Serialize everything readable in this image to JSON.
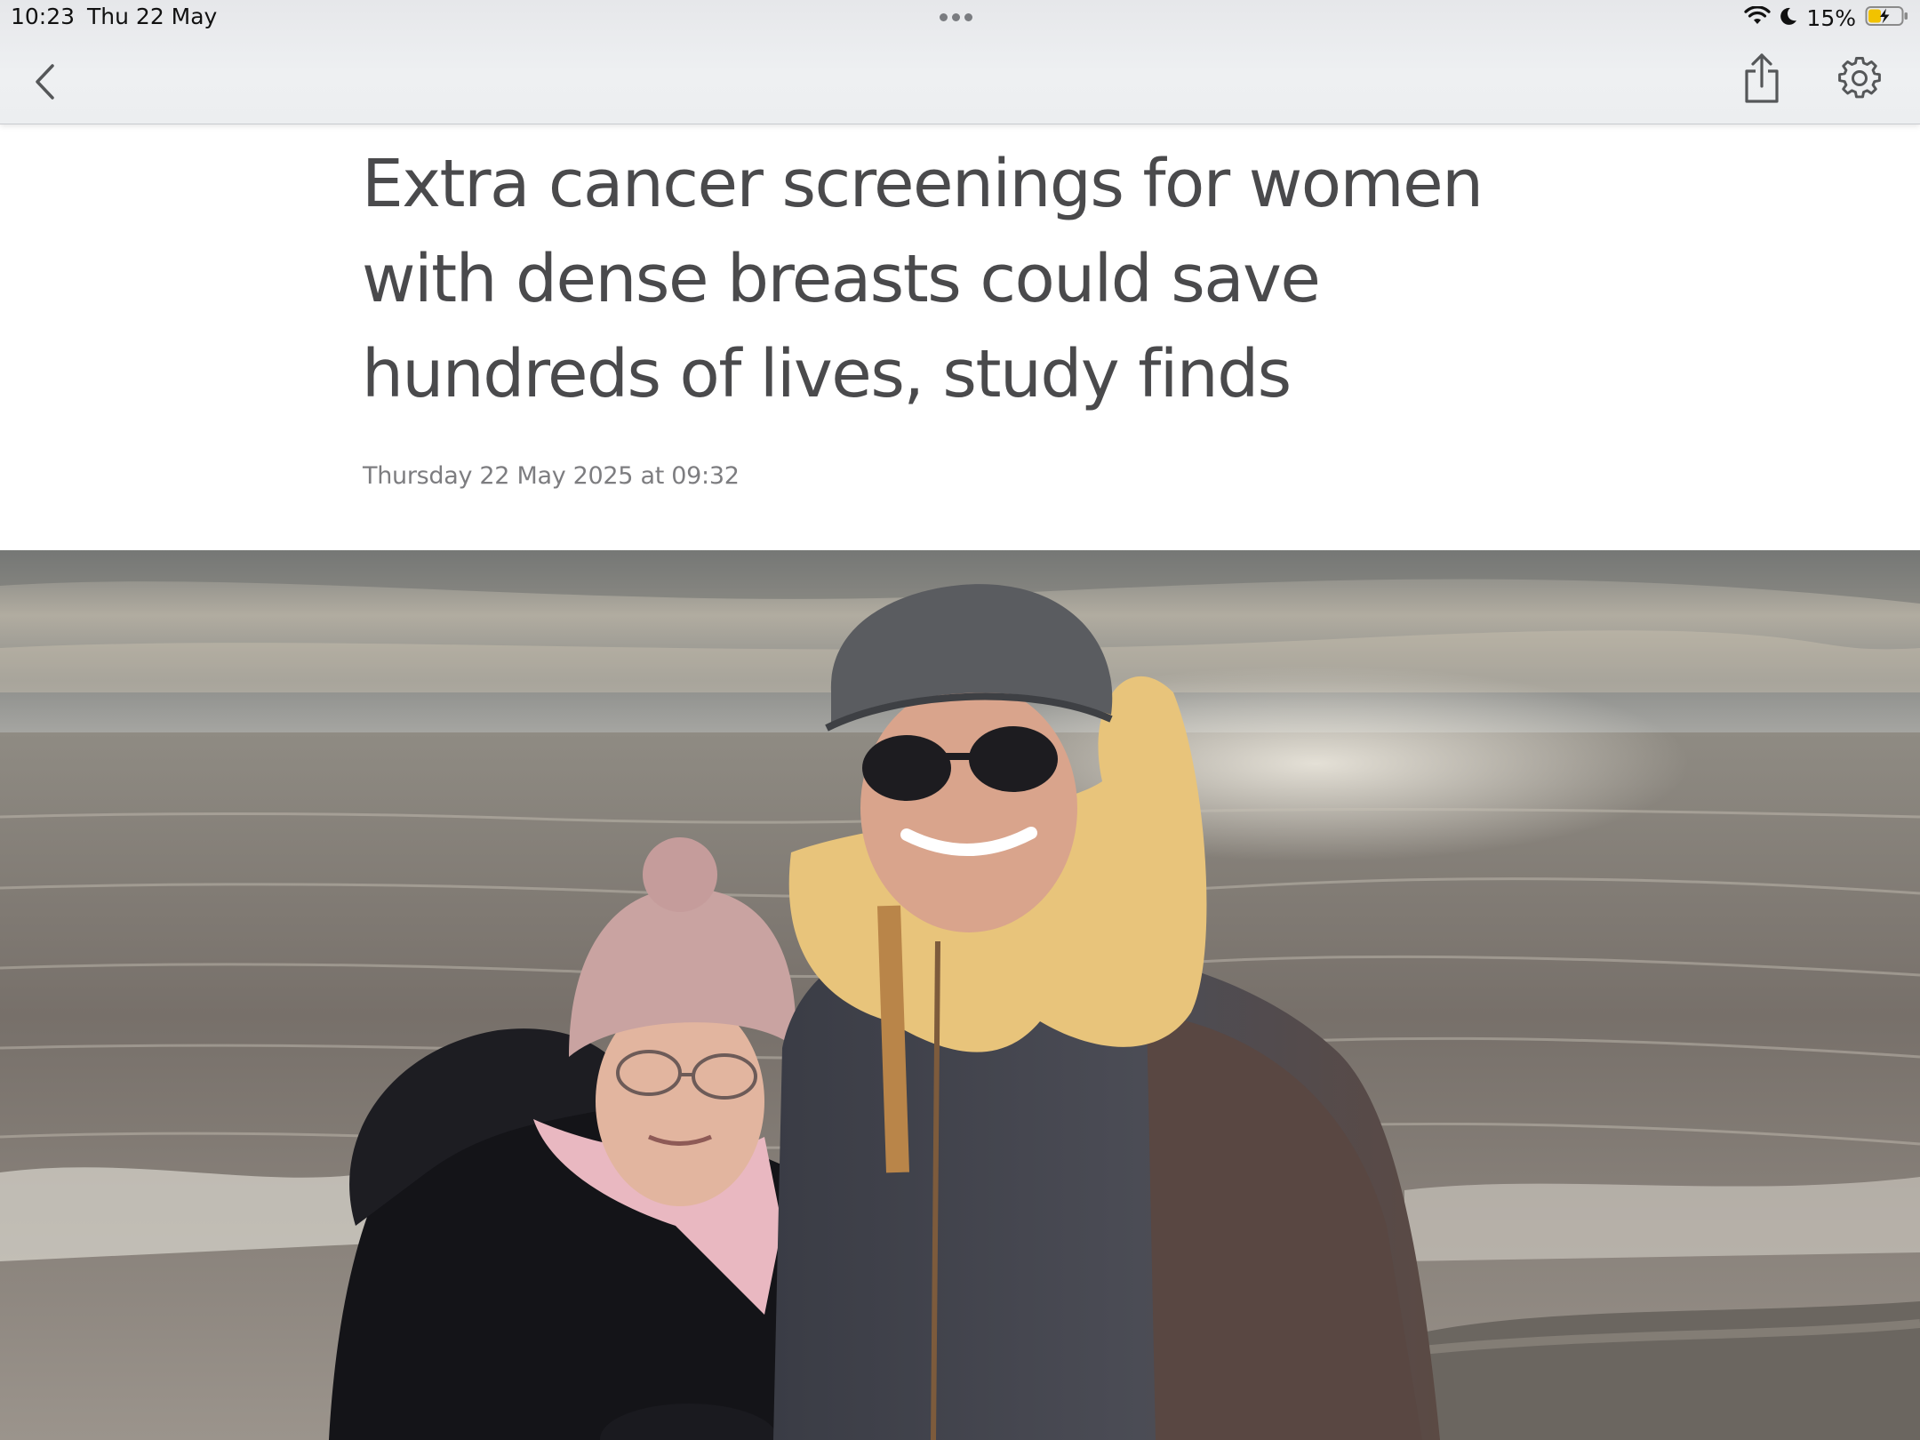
{
  "status_bar": {
    "time": "10:23",
    "date": "Thu 22 May",
    "battery_percent": "15%",
    "icons": [
      "wifi-icon",
      "moon-icon",
      "battery-charging-icon"
    ]
  },
  "toolbar": {
    "icons": [
      "chevron-left-icon",
      "share-icon",
      "gear-icon"
    ]
  },
  "article": {
    "headline": "Extra cancer screenings for women with dense breasts could save hundreds of lives, study finds",
    "timestamp": "Thursday 22 May 2025 at 09:32"
  },
  "colors": {
    "headline": "#4a4a4c",
    "timestamp": "#7d7d80",
    "chrome": "#eceef0",
    "battery_fill": "#f2c200"
  }
}
